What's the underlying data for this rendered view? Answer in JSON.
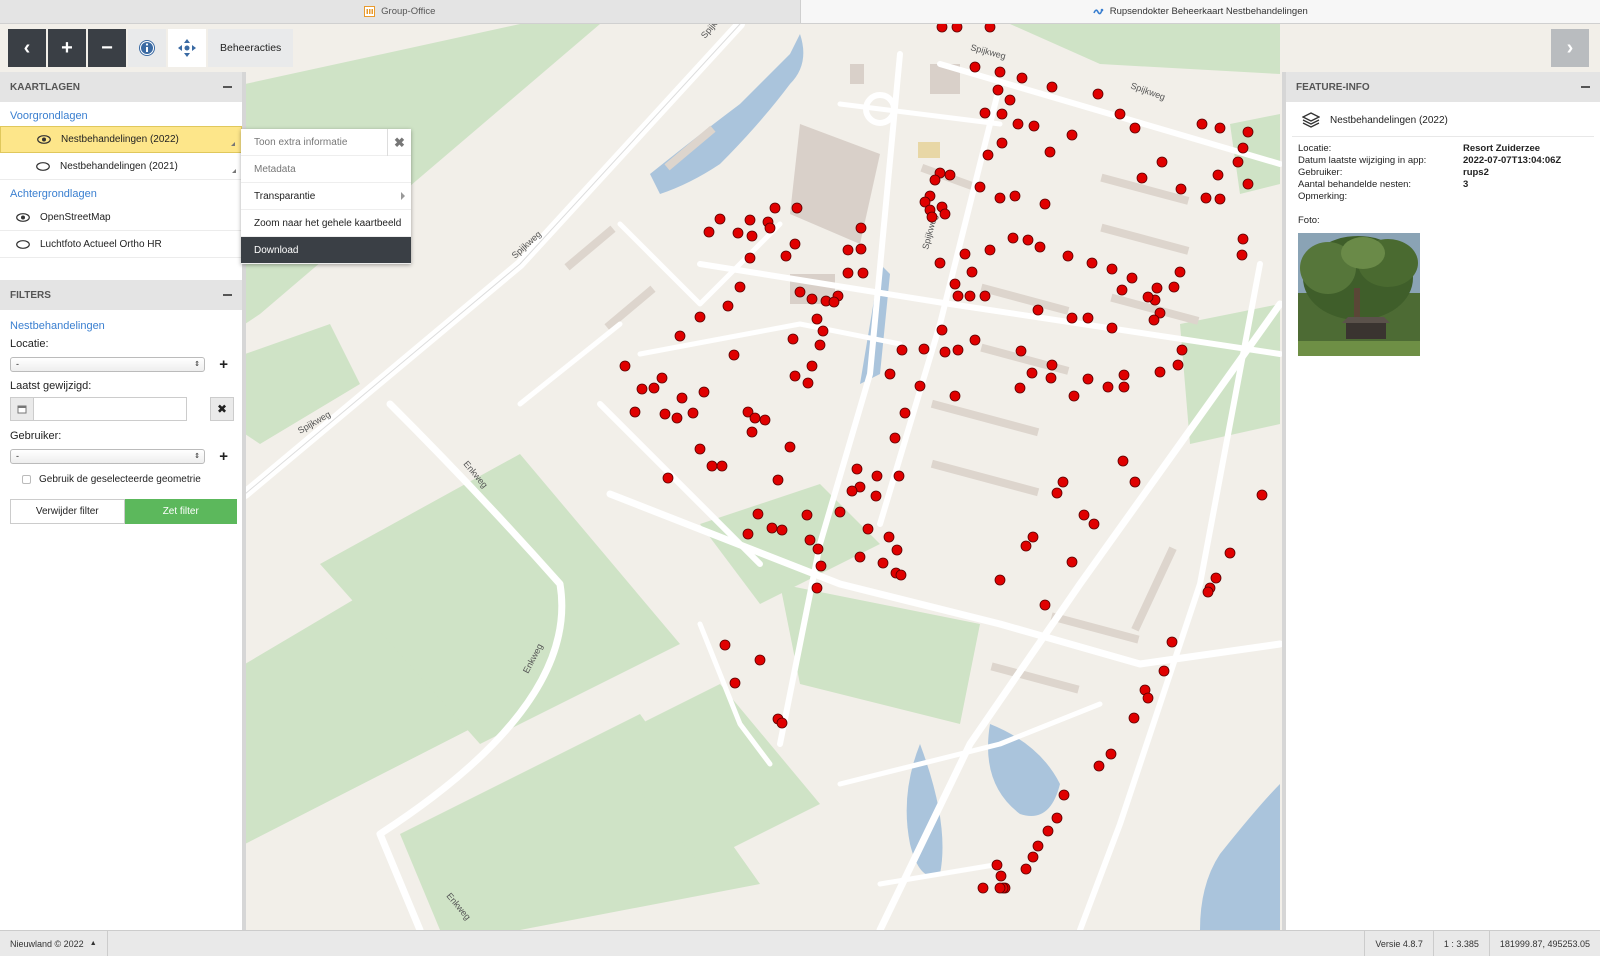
{
  "tabs": [
    {
      "label": "Group-Office",
      "icon": "group-office-icon"
    },
    {
      "label": "Rupsendokter Beheerkaart Nestbehandelingen",
      "icon": "rupsendokter-icon"
    }
  ],
  "toolbar": {
    "actions_label": "Beheeracties"
  },
  "left_panel": {
    "layers_title": "KAARTLAGEN",
    "foreground_title": "Voorgrondlagen",
    "foreground_layers": [
      "Nestbehandelingen (2022)",
      "Nestbehandelingen (2021)"
    ],
    "background_title": "Achtergrondlagen",
    "background_layers": [
      "OpenStreetMap",
      "Luchtfoto Actueel Ortho HR"
    ],
    "filters_title": "FILTERS",
    "filter_group": "Nestbehandelingen",
    "location_label": "Locatie:",
    "location_value": "-",
    "modified_label": "Laatst gewijzigd:",
    "user_label": "Gebruiker:",
    "user_value": "-",
    "geometry_label": "Gebruik de geselecteerde geometrie",
    "remove_filter": "Verwijder filter",
    "set_filter": "Zet filter"
  },
  "context_menu": {
    "items": [
      "Toon extra informatie",
      "Metadata",
      "Transparantie",
      "Zoom naar het gehele kaartbeeld",
      "Download"
    ]
  },
  "feature_info": {
    "title": "FEATURE-INFO",
    "layer": "Nestbehandelingen (2022)",
    "fields": [
      {
        "key": "Locatie:",
        "value": "Resort Zuiderzee"
      },
      {
        "key": "Datum laatste wijziging in app:",
        "value": "2022-07-07T13:04:06Z"
      },
      {
        "key": "Gebruiker:",
        "value": "rups2"
      },
      {
        "key": "Aantal behandelde nesten:",
        "value": "3"
      },
      {
        "key": "Opmerking:",
        "value": ""
      }
    ],
    "photo_label": "Foto:"
  },
  "map": {
    "street_labels": [
      "Spijkweg",
      "Spijkweg",
      "Spijkweg",
      "Spijkweg",
      "Spijkweg",
      "Spijkweg",
      "Enkweg",
      "Enkweg",
      "Enkweg"
    ]
  },
  "status": {
    "copyright": "Nieuwland © 2022",
    "version": "Versie 4.8.7",
    "scale": "1 : 3.385",
    "coordinates": "181999.87, 495253.05"
  },
  "colors": {
    "marker": "#e00000",
    "accent": "#3a7fd0",
    "selected_layer": "#fde68a",
    "set_filter": "#5cb85c"
  }
}
